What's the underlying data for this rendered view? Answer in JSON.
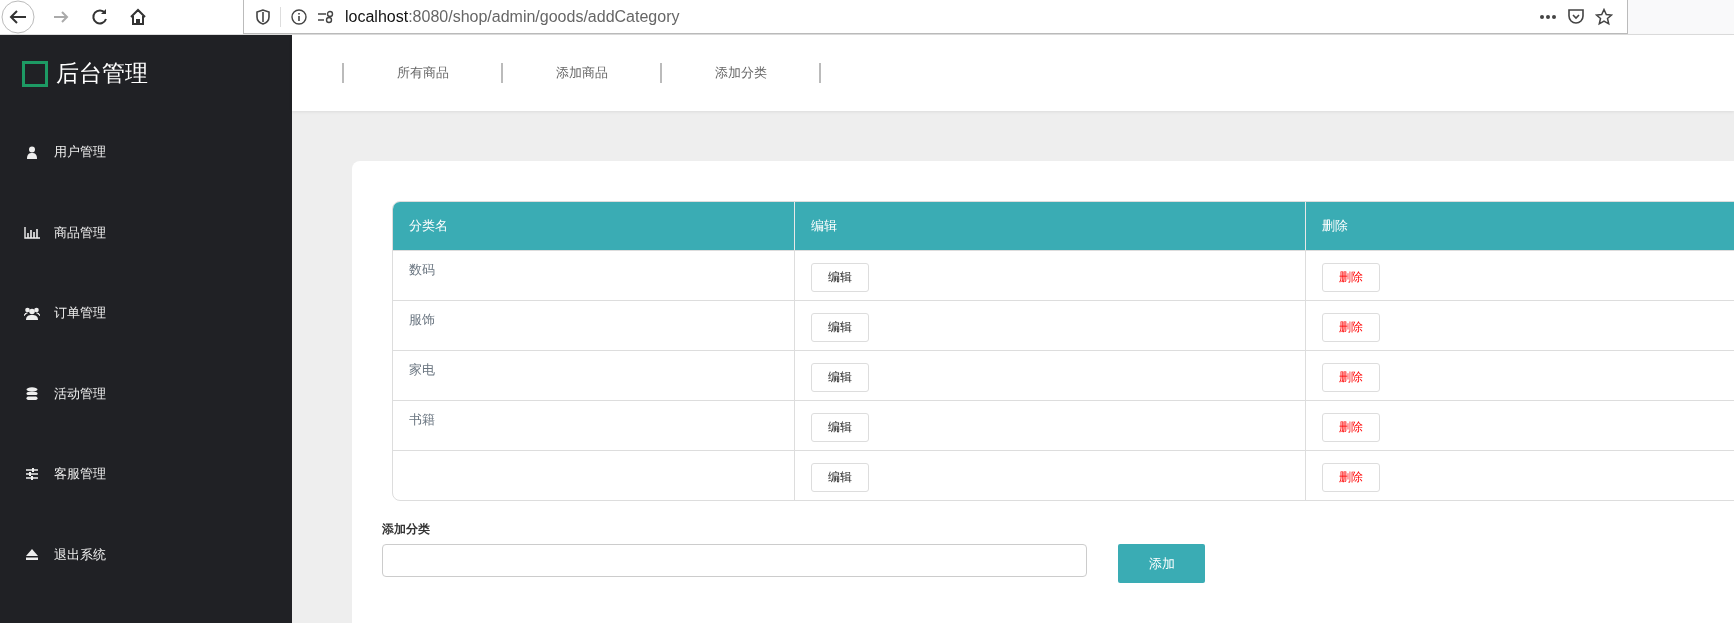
{
  "browser": {
    "url_host": "localhost",
    "url_rest": ":8080/shop/admin/goods/addCategory",
    "forward_disabled": true
  },
  "sidebar": {
    "title": "后台管理",
    "items": [
      {
        "label": "用户管理"
      },
      {
        "label": "商品管理"
      },
      {
        "label": "订单管理"
      },
      {
        "label": "活动管理"
      },
      {
        "label": "客服管理"
      },
      {
        "label": "退出系统"
      }
    ]
  },
  "nav": [
    "所有商品",
    "添加商品",
    "添加分类"
  ],
  "table": {
    "columns": [
      "分类名",
      "编辑",
      "删除"
    ],
    "rows": [
      {
        "name": "数码",
        "edit": "编辑",
        "delete": "删除"
      },
      {
        "name": "服饰",
        "edit": "编辑",
        "delete": "删除"
      },
      {
        "name": "家电",
        "edit": "编辑",
        "delete": "删除"
      },
      {
        "name": "书籍",
        "edit": "编辑",
        "delete": "删除"
      },
      {
        "edit": "编辑",
        "delete": "删除"
      }
    ]
  },
  "form": {
    "label": "添加分类",
    "button": "添加"
  }
}
